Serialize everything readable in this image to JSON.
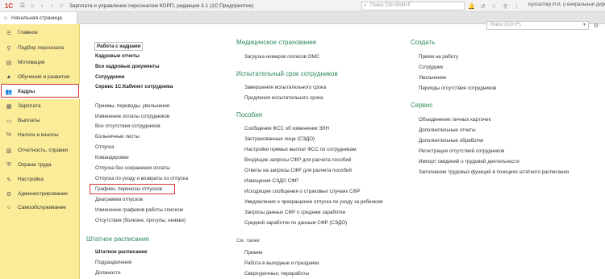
{
  "titlebar": {
    "logo": "1С",
    "title": "Зарплата и управление персоналом КОРП, редакция 3.1 (1С:Предприятие)",
    "search_placeholder": "Поиск Ctrl+Shift+F",
    "user": "Бухгалтер И.В. (Генеральный директор)"
  },
  "tab": {
    "label": "Начальная страница"
  },
  "sidebar": {
    "items": [
      {
        "label": "Главное",
        "icon": "menu-icon"
      },
      {
        "label": "Подбор персонала",
        "icon": "person-search-icon"
      },
      {
        "label": "Мотивация",
        "icon": "chart-icon"
      },
      {
        "label": "Обучение и развитие",
        "icon": "graduation-icon"
      },
      {
        "label": "Кадры",
        "icon": "people-icon"
      },
      {
        "label": "Зарплата",
        "icon": "salary-icon"
      },
      {
        "label": "Выплаты",
        "icon": "payments-icon"
      },
      {
        "label": "Налоги и взносы",
        "icon": "taxes-icon"
      },
      {
        "label": "Отчетность, справки",
        "icon": "reports-icon"
      },
      {
        "label": "Охрана труда",
        "icon": "safety-icon"
      },
      {
        "label": "Настройка",
        "icon": "settings-icon"
      },
      {
        "label": "Администрирование",
        "icon": "admin-icon"
      },
      {
        "label": "Самообслуживание",
        "icon": "self-service-icon"
      }
    ]
  },
  "content": {
    "search_placeholder": "Поиск (Ctrl+F)",
    "col1": {
      "bold_links": [
        "Работа с кадрами",
        "Кадровые отчеты",
        "Все кадровые документы",
        "Сотрудники",
        "Сервис 1С:Кабинет сотрудника"
      ],
      "links": [
        "Приемы, переводы, увольнения",
        "Изменение оплаты сотрудников",
        "Все отсутствия сотрудников",
        "Больничные листы",
        "Отпуска",
        "Командировки",
        "Отпуска без сохранения оплаты",
        "Отпуска по уходу и возвраты из отпуска",
        "Графики, переносы отпусков",
        "Диаграмма отпусков",
        "Изменение графиков работы списком",
        "Отсутствия (болезни, прогулы, неявки)"
      ],
      "section2_heading": "Штатное расписание",
      "section2_bold": "Штатное расписание",
      "section2_links": [
        "Подразделения",
        "Должности"
      ]
    },
    "col2": {
      "heading1": "Медицинское страхование",
      "links1": [
        "Загрузка номеров полисов ОМС"
      ],
      "heading2": "Испытательный срок сотрудников",
      "links2": [
        "Завершения испытательного срока",
        "Продления испытательного срока"
      ],
      "heading3": "Пособия",
      "links3": [
        "Сообщения ФСС об изменении ЭЛН",
        "Застрахованные лица (СЭДО)",
        "Настройки прямых выплат ФСС по сотрудникам",
        "Входящие запросы СФР для расчета пособий",
        "Ответы на запросы СФР для расчета пособий",
        "Извещения СЭДО СФР",
        "Исходящие сообщения о страховых случаях СФР",
        "Уведомления о прекращении отпуска по уходу за ребенком",
        "Запросы данных СФР о среднем заработке",
        "Средний заработок по данным СФР (СЭДО)"
      ],
      "see_also": "См. также",
      "links4": [
        "Премии",
        "Работа в выходные и праздники",
        "Сверхурочные, переработы"
      ]
    },
    "col3": {
      "heading1": "Создать",
      "links1": [
        "Прием на работу",
        "Сотрудник",
        "Увольнение",
        "Периоды отсутствия сотрудников"
      ],
      "heading2": "Сервис",
      "links2": [
        "Объединение личных карточек",
        "Дополнительные отчеты",
        "Дополнительные обработки",
        "Регистрация отсутствий сотрудников",
        "Импорт сведений о трудовой деятельности",
        "Заполнение трудовых функций в позициях штатного расписания"
      ]
    }
  },
  "colors": {
    "sidebar_bg": "#fbec9a",
    "heading": "#2b8a5a",
    "highlight": "#d9342b",
    "logo": "#d43b2a"
  }
}
